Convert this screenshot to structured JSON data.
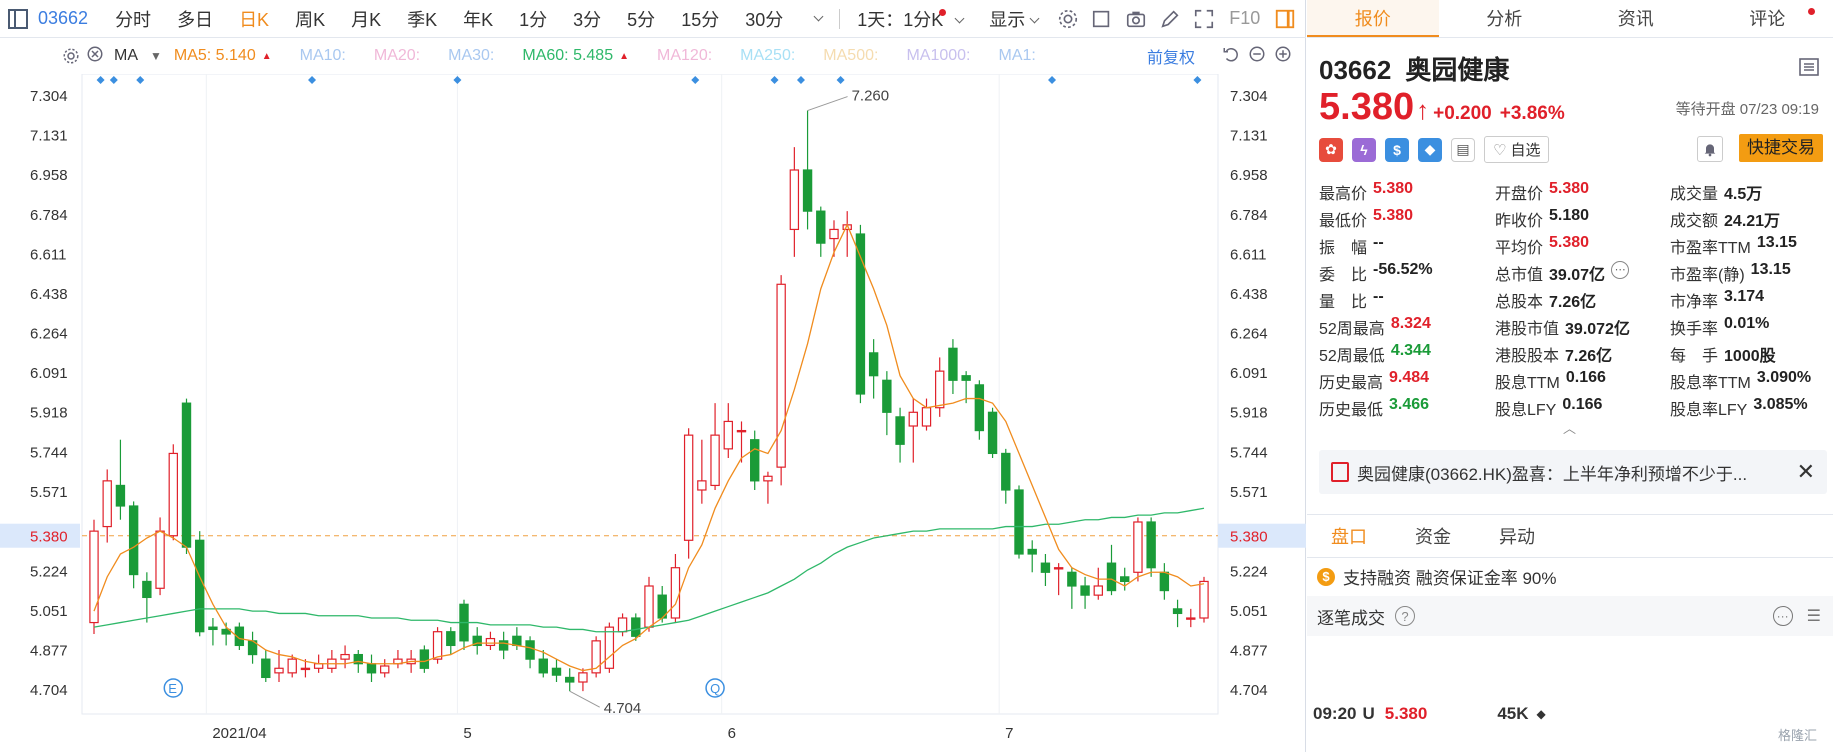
{
  "toolbar": {
    "code": "03662",
    "periods": [
      "分时",
      "多日",
      "日K",
      "周K",
      "月K",
      "季K",
      "年K",
      "1分",
      "3分",
      "5分",
      "15分",
      "30分"
    ],
    "active_period": "日K",
    "multi_period": "1天：1分K",
    "display_label": "显示",
    "f10_label": "F10"
  },
  "ma_legend": {
    "title": "MA",
    "items": [
      {
        "label": "MA5: 5.140",
        "color": "#f08c1e",
        "up": true
      },
      {
        "label": "MA10:",
        "color": "#a9c8f0"
      },
      {
        "label": "MA20:",
        "color": "#f0b8d8"
      },
      {
        "label": "MA30:",
        "color": "#a9c8f0"
      },
      {
        "label": "MA60: 5.485",
        "color": "#2fb86a",
        "up": true
      },
      {
        "label": "MA120:",
        "color": "#f0b8d8"
      },
      {
        "label": "MA250:",
        "color": "#a8e0f5"
      },
      {
        "label": "MA500:",
        "color": "#f5dcb0"
      },
      {
        "label": "MA1000:",
        "color": "#c8c0ee"
      },
      {
        "label": "MA1:",
        "color": "#a9c8f0"
      }
    ],
    "adjust_label": "前复权"
  },
  "chart_data": {
    "type": "candlestick",
    "y_ticks": [
      "7.304",
      "7.131",
      "6.958",
      "6.784",
      "6.611",
      "6.438",
      "6.264",
      "6.091",
      "5.918",
      "5.744",
      "5.571",
      "5.380",
      "5.224",
      "5.051",
      "4.877",
      "4.704"
    ],
    "ylim": [
      4.6,
      7.4
    ],
    "x_labels": [
      {
        "label": "2021/04",
        "i": 9
      },
      {
        "label": "5",
        "i": 28
      },
      {
        "label": "6",
        "i": 48
      },
      {
        "label": "7",
        "i": 69
      }
    ],
    "current_price": "5.380",
    "max_label": "7.260",
    "min_label": "4.704",
    "candles": [
      [
        5.0,
        5.4,
        5.45,
        4.95
      ],
      [
        5.42,
        5.62,
        5.67,
        5.35
      ],
      [
        5.6,
        5.51,
        5.8,
        5.45
      ],
      [
        5.51,
        5.21,
        5.53,
        5.15
      ],
      [
        5.18,
        5.11,
        5.22,
        5.0
      ],
      [
        5.15,
        5.4,
        5.46,
        5.12
      ],
      [
        5.38,
        5.74,
        5.78,
        5.36
      ],
      [
        5.96,
        5.33,
        5.98,
        5.3
      ],
      [
        5.36,
        4.96,
        5.4,
        4.94
      ],
      [
        4.98,
        4.97,
        5.02,
        4.9
      ],
      [
        4.97,
        4.95,
        5.0,
        4.9
      ],
      [
        4.98,
        4.9,
        5.0,
        4.88
      ],
      [
        4.92,
        4.86,
        4.96,
        4.82
      ],
      [
        4.84,
        4.76,
        4.88,
        4.74
      ],
      [
        4.78,
        4.8,
        4.88,
        4.74
      ],
      [
        4.78,
        4.84,
        4.86,
        4.76
      ],
      [
        4.8,
        4.8,
        4.84,
        4.76
      ],
      [
        4.8,
        4.82,
        4.86,
        4.78
      ],
      [
        4.8,
        4.84,
        4.88,
        4.78
      ],
      [
        4.84,
        4.86,
        4.9,
        4.8
      ],
      [
        4.86,
        4.82,
        4.88,
        4.78
      ],
      [
        4.82,
        4.78,
        4.86,
        4.74
      ],
      [
        4.78,
        4.81,
        4.84,
        4.76
      ],
      [
        4.82,
        4.84,
        4.88,
        4.8
      ],
      [
        4.82,
        4.84,
        4.88,
        4.78
      ],
      [
        4.88,
        4.8,
        4.9,
        4.78
      ],
      [
        4.84,
        4.96,
        4.98,
        4.82
      ],
      [
        4.96,
        4.9,
        4.98,
        4.86
      ],
      [
        5.08,
        4.92,
        5.1,
        4.88
      ],
      [
        4.94,
        4.9,
        4.98,
        4.86
      ],
      [
        4.9,
        4.93,
        4.96,
        4.88
      ],
      [
        4.92,
        4.88,
        4.96,
        4.84
      ],
      [
        4.94,
        4.9,
        4.98,
        4.88
      ],
      [
        4.92,
        4.84,
        4.94,
        4.8
      ],
      [
        4.84,
        4.78,
        4.88,
        4.76
      ],
      [
        4.8,
        4.77,
        4.84,
        4.74
      ],
      [
        4.76,
        4.74,
        4.8,
        4.7
      ],
      [
        4.74,
        4.78,
        4.8,
        4.7
      ],
      [
        4.78,
        4.92,
        4.94,
        4.76
      ],
      [
        4.8,
        4.98,
        5.0,
        4.78
      ],
      [
        4.96,
        5.02,
        5.04,
        4.94
      ],
      [
        5.02,
        4.94,
        5.04,
        4.92
      ],
      [
        4.98,
        5.16,
        5.2,
        4.96
      ],
      [
        5.12,
        5.02,
        5.16,
        5.0
      ],
      [
        5.02,
        5.24,
        5.3,
        5.0
      ],
      [
        5.36,
        5.82,
        5.85,
        5.28
      ],
      [
        5.58,
        5.62,
        5.8,
        5.52
      ],
      [
        5.6,
        5.82,
        5.96,
        5.58
      ],
      [
        5.76,
        5.88,
        5.96,
        5.72
      ],
      [
        5.84,
        5.84,
        5.88,
        5.7
      ],
      [
        5.8,
        5.62,
        5.84,
        5.58
      ],
      [
        5.62,
        5.64,
        5.66,
        5.52
      ],
      [
        5.68,
        6.48,
        6.52,
        5.6
      ],
      [
        6.72,
        6.98,
        7.08,
        6.6
      ],
      [
        6.98,
        6.8,
        7.24,
        6.72
      ],
      [
        6.8,
        6.66,
        6.82,
        6.6
      ],
      [
        6.68,
        6.72,
        6.76,
        6.6
      ],
      [
        6.72,
        6.74,
        6.8,
        6.6
      ],
      [
        6.7,
        6.0,
        6.74,
        5.96
      ],
      [
        6.18,
        6.08,
        6.24,
        5.98
      ],
      [
        6.06,
        5.92,
        6.1,
        5.82
      ],
      [
        5.9,
        5.78,
        5.94,
        5.7
      ],
      [
        5.86,
        5.92,
        5.98,
        5.7
      ],
      [
        5.86,
        5.94,
        5.98,
        5.84
      ],
      [
        5.94,
        6.1,
        6.16,
        5.9
      ],
      [
        6.2,
        6.06,
        6.24,
        6.0
      ],
      [
        6.08,
        6.06,
        6.1,
        5.96
      ],
      [
        6.04,
        5.84,
        6.06,
        5.8
      ],
      [
        5.92,
        5.74,
        5.94,
        5.72
      ],
      [
        5.74,
        5.58,
        5.76,
        5.52
      ],
      [
        5.58,
        5.3,
        5.6,
        5.28
      ],
      [
        5.32,
        5.3,
        5.36,
        5.22
      ],
      [
        5.26,
        5.22,
        5.3,
        5.16
      ],
      [
        5.24,
        5.24,
        5.26,
        5.12
      ],
      [
        5.22,
        5.16,
        5.24,
        5.06
      ],
      [
        5.16,
        5.12,
        5.2,
        5.06
      ],
      [
        5.12,
        5.16,
        5.24,
        5.1
      ],
      [
        5.26,
        5.14,
        5.34,
        5.12
      ],
      [
        5.2,
        5.18,
        5.24,
        5.14
      ],
      [
        5.22,
        5.44,
        5.46,
        5.18
      ],
      [
        5.44,
        5.24,
        5.46,
        5.2
      ],
      [
        5.22,
        5.14,
        5.26,
        5.1
      ],
      [
        5.06,
        5.04,
        5.1,
        4.98
      ],
      [
        5.02,
        5.02,
        5.06,
        4.98
      ],
      [
        5.02,
        5.18,
        5.2,
        5.0
      ]
    ],
    "ma5": [
      5.05,
      5.2,
      5.3,
      5.33,
      5.37,
      5.4,
      5.37,
      5.33,
      5.2,
      5.08,
      4.98,
      4.93,
      4.92,
      4.88,
      4.86,
      4.85,
      4.83,
      4.82,
      4.82,
      4.82,
      4.83,
      4.82,
      4.82,
      4.82,
      4.83,
      4.83,
      4.85,
      4.86,
      4.89,
      4.91,
      4.91,
      4.91,
      4.9,
      4.89,
      4.87,
      4.84,
      4.81,
      4.79,
      4.8,
      4.85,
      4.9,
      4.93,
      4.98,
      5.02,
      5.08,
      5.24,
      5.34,
      5.5,
      5.62,
      5.72,
      5.76,
      5.74,
      5.84,
      6.02,
      6.22,
      6.46,
      6.62,
      6.74,
      6.6,
      6.46,
      6.3,
      6.08,
      5.98,
      5.94,
      5.95,
      5.96,
      5.98,
      5.98,
      5.96,
      5.88,
      5.74,
      5.6,
      5.46,
      5.32,
      5.24,
      5.21,
      5.19,
      5.19,
      5.16,
      5.2,
      5.22,
      5.22,
      5.2,
      5.16,
      5.17
    ],
    "ma60": [
      4.98,
      4.99,
      5.0,
      5.01,
      5.02,
      5.03,
      5.04,
      5.05,
      5.06,
      5.06,
      5.06,
      5.06,
      5.05,
      5.05,
      5.04,
      5.04,
      5.04,
      5.03,
      5.03,
      5.03,
      5.03,
      5.02,
      5.02,
      5.02,
      5.01,
      5.01,
      5.01,
      5.0,
      5.0,
      5.0,
      4.99,
      4.99,
      4.99,
      4.99,
      4.98,
      4.98,
      4.97,
      4.97,
      4.96,
      4.96,
      4.96,
      4.97,
      4.98,
      4.99,
      5.0,
      5.01,
      5.03,
      5.05,
      5.07,
      5.09,
      5.11,
      5.13,
      5.16,
      5.19,
      5.23,
      5.26,
      5.3,
      5.33,
      5.35,
      5.37,
      5.38,
      5.39,
      5.4,
      5.4,
      5.41,
      5.41,
      5.41,
      5.41,
      5.41,
      5.42,
      5.42,
      5.42,
      5.43,
      5.43,
      5.44,
      5.45,
      5.45,
      5.46,
      5.46,
      5.47,
      5.47,
      5.48,
      5.48,
      5.49,
      5.5
    ]
  },
  "right": {
    "tabs": [
      "报价",
      "分析",
      "资讯",
      "评论"
    ],
    "active_tab": "报价",
    "code": "03662",
    "name": "奥园健康",
    "price": "5.380",
    "change": "+0.200",
    "pct": "+3.86%",
    "status": "等待开盘 07/23 09:19",
    "fav_label": "自选",
    "quick_trade": "快捷交易",
    "quote_rows": [
      [
        {
          "l": "最高价",
          "v": "5.380",
          "c": "red"
        },
        {
          "l": "开盘价",
          "v": "5.380",
          "c": "red"
        },
        {
          "l": "成交量",
          "v": "4.5万",
          "c": ""
        }
      ],
      [
        {
          "l": "最低价",
          "v": "5.380",
          "c": "red"
        },
        {
          "l": "昨收价",
          "v": "5.180",
          "c": ""
        },
        {
          "l": "成交额",
          "v": "24.21万",
          "c": ""
        }
      ],
      [
        {
          "l": "振　幅",
          "v": "--",
          "c": ""
        },
        {
          "l": "平均价",
          "v": "5.380",
          "c": "red"
        },
        {
          "l": "市盈率TTM",
          "v": "13.15",
          "c": ""
        }
      ],
      [
        {
          "l": "委　比",
          "v": "-56.52%",
          "c": ""
        },
        {
          "l": "总市值",
          "v": "39.07亿",
          "c": ""
        },
        {
          "l": "市盈率(静)",
          "v": "13.15",
          "c": ""
        }
      ],
      [
        {
          "l": "量　比",
          "v": "--",
          "c": ""
        },
        {
          "l": "总股本",
          "v": "7.26亿",
          "c": ""
        },
        {
          "l": "市净率",
          "v": "3.174",
          "c": ""
        }
      ],
      [
        {
          "l": "52周最高",
          "v": "8.324",
          "c": "red"
        },
        {
          "l": "港股市值",
          "v": "39.072亿",
          "c": ""
        },
        {
          "l": "换手率",
          "v": "0.01%",
          "c": ""
        }
      ],
      [
        {
          "l": "52周最低",
          "v": "4.344",
          "c": "green"
        },
        {
          "l": "港股股本",
          "v": "7.26亿",
          "c": ""
        },
        {
          "l": "每　手",
          "v": "1000股",
          "c": ""
        }
      ],
      [
        {
          "l": "历史最高",
          "v": "9.484",
          "c": "red"
        },
        {
          "l": "股息TTM",
          "v": "0.166",
          "c": ""
        },
        {
          "l": "股息率TTM",
          "v": "3.090%",
          "c": ""
        }
      ],
      [
        {
          "l": "历史最低",
          "v": "3.466",
          "c": "green"
        },
        {
          "l": "股息LFY",
          "v": "0.166",
          "c": ""
        },
        {
          "l": "股息率LFY",
          "v": "3.085%",
          "c": ""
        }
      ]
    ],
    "news": "奥园健康(03662.HK)盈喜：上半年净利预增不少于...",
    "sub_tabs": [
      "盘口",
      "资金",
      "异动"
    ],
    "active_sub": "盘口",
    "margin_text": "支持融资  融资保证金率 90%",
    "trade_title": "逐笔成交",
    "trade": {
      "time": "09:20",
      "flag": "U",
      "price": "5.380",
      "vol": "45K"
    },
    "watermark": "格隆汇"
  }
}
